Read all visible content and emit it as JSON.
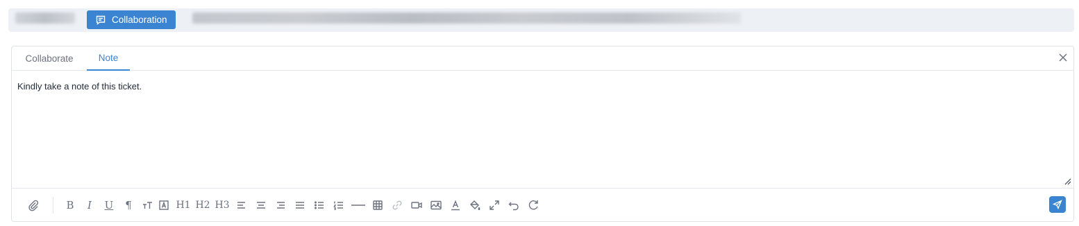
{
  "topbar": {
    "collaboration_label": "Collaboration"
  },
  "tabs": [
    {
      "label": "Collaborate",
      "active": false
    },
    {
      "label": "Note",
      "active": true
    }
  ],
  "editor": {
    "content": "Kindly take a note of this ticket."
  },
  "toolbar": {
    "items": [
      "attach-icon",
      "bold-icon",
      "italic-icon",
      "underline-icon",
      "paragraph-icon",
      "font-size-icon",
      "text-box-icon",
      "H1",
      "H2",
      "H3",
      "align-left-icon",
      "align-center-icon",
      "align-right-icon",
      "align-justify-icon",
      "bullet-list-icon",
      "numbered-list-icon",
      "horizontal-rule-icon",
      "table-icon",
      "link-icon",
      "video-icon",
      "image-icon",
      "font-color-icon",
      "fill-color-icon",
      "fullscreen-icon",
      "undo-icon",
      "redo-icon"
    ],
    "h1": "H1",
    "h2": "H2",
    "h3": "H3",
    "bold": "B",
    "italic": "I",
    "underline": "U",
    "paragraph": "¶"
  },
  "colors": {
    "accent": "#3b84d1",
    "topbar_bg": "#edf0f4",
    "icon": "#6b7280"
  }
}
